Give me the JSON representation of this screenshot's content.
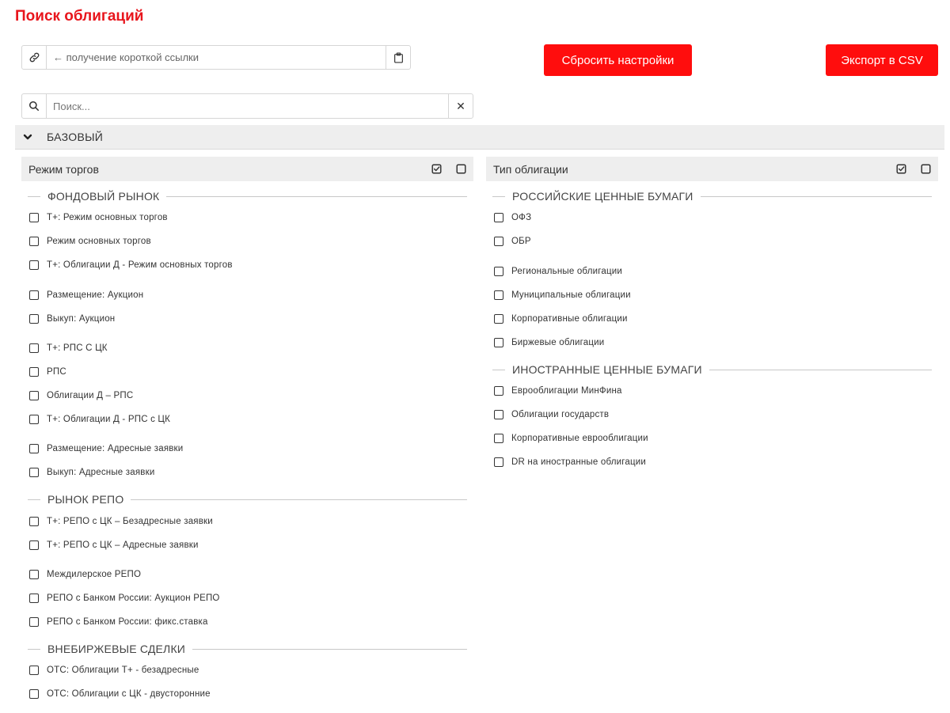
{
  "page": {
    "title": "Поиск облигаций"
  },
  "link": {
    "text": "← получение короткой ссылки"
  },
  "actions": {
    "reset_label": "Сбросить настройки",
    "export_label": "Экспорт в CSV"
  },
  "search": {
    "placeholder": "Поиск...",
    "clear_symbol": "✕"
  },
  "section": {
    "title": "БАЗОВЫЙ",
    "expanded": true
  },
  "colors": {
    "accent": "#ff0d0d",
    "title": "#e8151c",
    "panel_bg": "#eeeeee"
  },
  "left_panel": {
    "title": "Режим торгов",
    "groups": [
      {
        "title": "ФОНДОВЫЙ РЫНОК",
        "items": [
          {
            "label": "Т+: Режим основных торгов",
            "checked": false
          },
          {
            "label": "Режим основных торгов",
            "checked": false
          },
          {
            "label": "Т+: Облигации Д - Режим основных торгов",
            "checked": false
          },
          {
            "label": "Размещение: Аукцион",
            "checked": false
          },
          {
            "label": "Выкуп: Аукцион",
            "checked": false
          },
          {
            "label": "Т+: РПС С ЦК",
            "checked": false
          },
          {
            "label": "РПС",
            "checked": false
          },
          {
            "label": "Облигации Д – РПС",
            "checked": false
          },
          {
            "label": "Т+: Облигации Д - РПС с ЦК",
            "checked": false
          },
          {
            "label": "Размещение: Адресные заявки",
            "checked": false
          },
          {
            "label": "Выкуп: Адресные заявки",
            "checked": false
          }
        ]
      },
      {
        "title": "РЫНОК РЕПО",
        "items": [
          {
            "label": "Т+: РЕПО с ЦК – Безадресные заявки",
            "checked": false
          },
          {
            "label": "Т+: РЕПО с ЦК – Адресные заявки",
            "checked": false
          },
          {
            "label": "Междилерское РЕПО",
            "checked": false
          },
          {
            "label": "РЕПО с Банком России: Аукцион РЕПО",
            "checked": false
          },
          {
            "label": "РЕПО с Банком России: фикс.ставка",
            "checked": false
          }
        ]
      },
      {
        "title": "ВНЕБИРЖЕВЫЕ СДЕЛКИ",
        "items": [
          {
            "label": "ОТС: Облигации Т+ - безадресные",
            "checked": false
          },
          {
            "label": "ОТС: Облигации с ЦК - двусторонние",
            "checked": false
          }
        ]
      }
    ]
  },
  "right_panel": {
    "title": "Тип облигации",
    "groups": [
      {
        "title": "РОССИЙСКИЕ ЦЕННЫЕ БУМАГИ",
        "items": [
          {
            "label": "ОФЗ",
            "checked": false
          },
          {
            "label": "ОБР",
            "checked": false
          },
          {
            "label": "Региональные облигации",
            "checked": false
          },
          {
            "label": "Муниципальные облигации",
            "checked": false
          },
          {
            "label": "Корпоративные облигации",
            "checked": false
          },
          {
            "label": "Биржевые облигации",
            "checked": false
          }
        ]
      },
      {
        "title": "ИНОСТРАННЫЕ ЦЕННЫЕ БУМАГИ",
        "items": [
          {
            "label": "Еврооблигации МинФина",
            "checked": false
          },
          {
            "label": "Облигации государств",
            "checked": false
          },
          {
            "label": "Корпоративные еврооблигации",
            "checked": false
          },
          {
            "label": "DR на иностранные облигации",
            "checked": false
          }
        ]
      }
    ]
  }
}
